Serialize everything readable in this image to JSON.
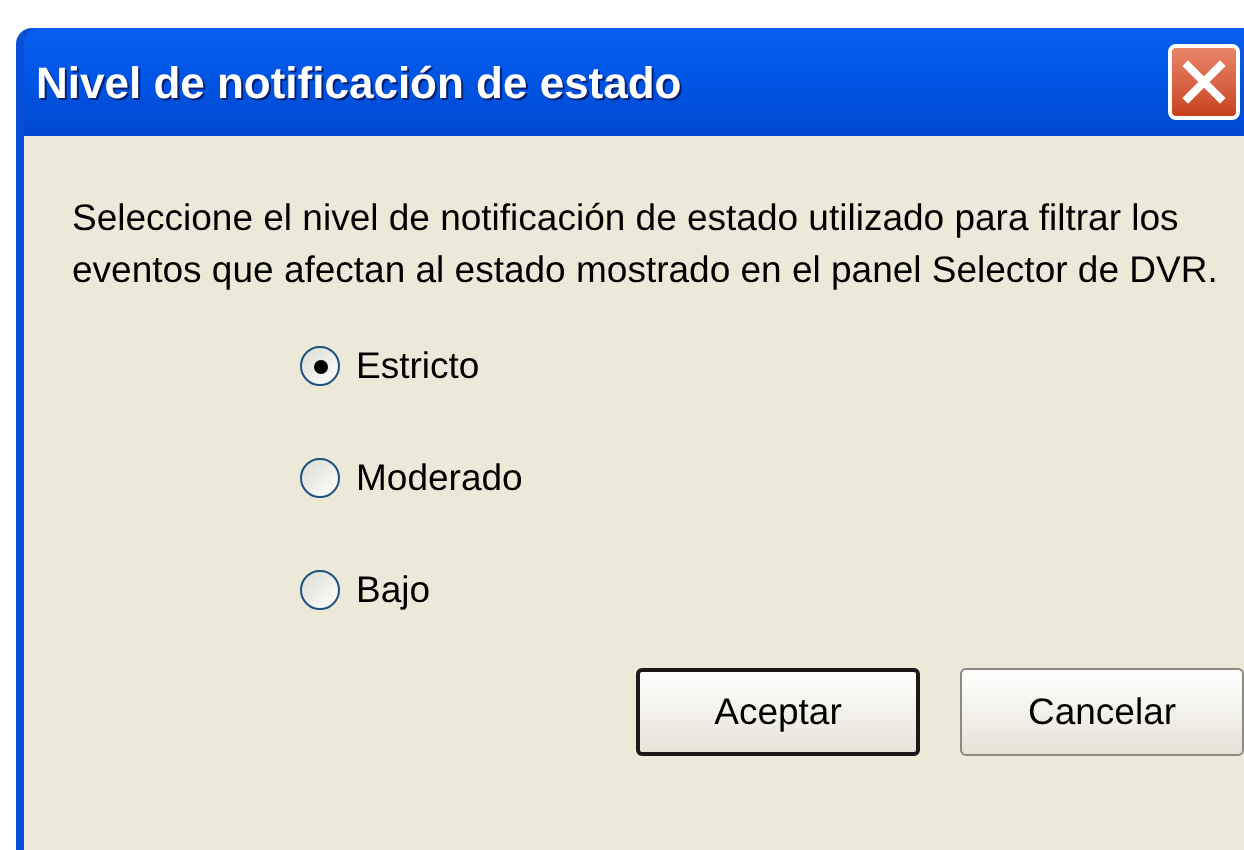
{
  "window": {
    "title": "Nivel de notificación de estado"
  },
  "description": "Seleccione el nivel de notificación de estado utilizado para filtrar los eventos que afectan al estado mostrado en el panel Selector de DVR.",
  "options": [
    {
      "label": "Estricto",
      "selected": true
    },
    {
      "label": "Moderado",
      "selected": false
    },
    {
      "label": "Bajo",
      "selected": false
    }
  ],
  "buttons": [
    {
      "label": "Aceptar",
      "default": true
    },
    {
      "label": "Cancelar",
      "default": false
    }
  ]
}
